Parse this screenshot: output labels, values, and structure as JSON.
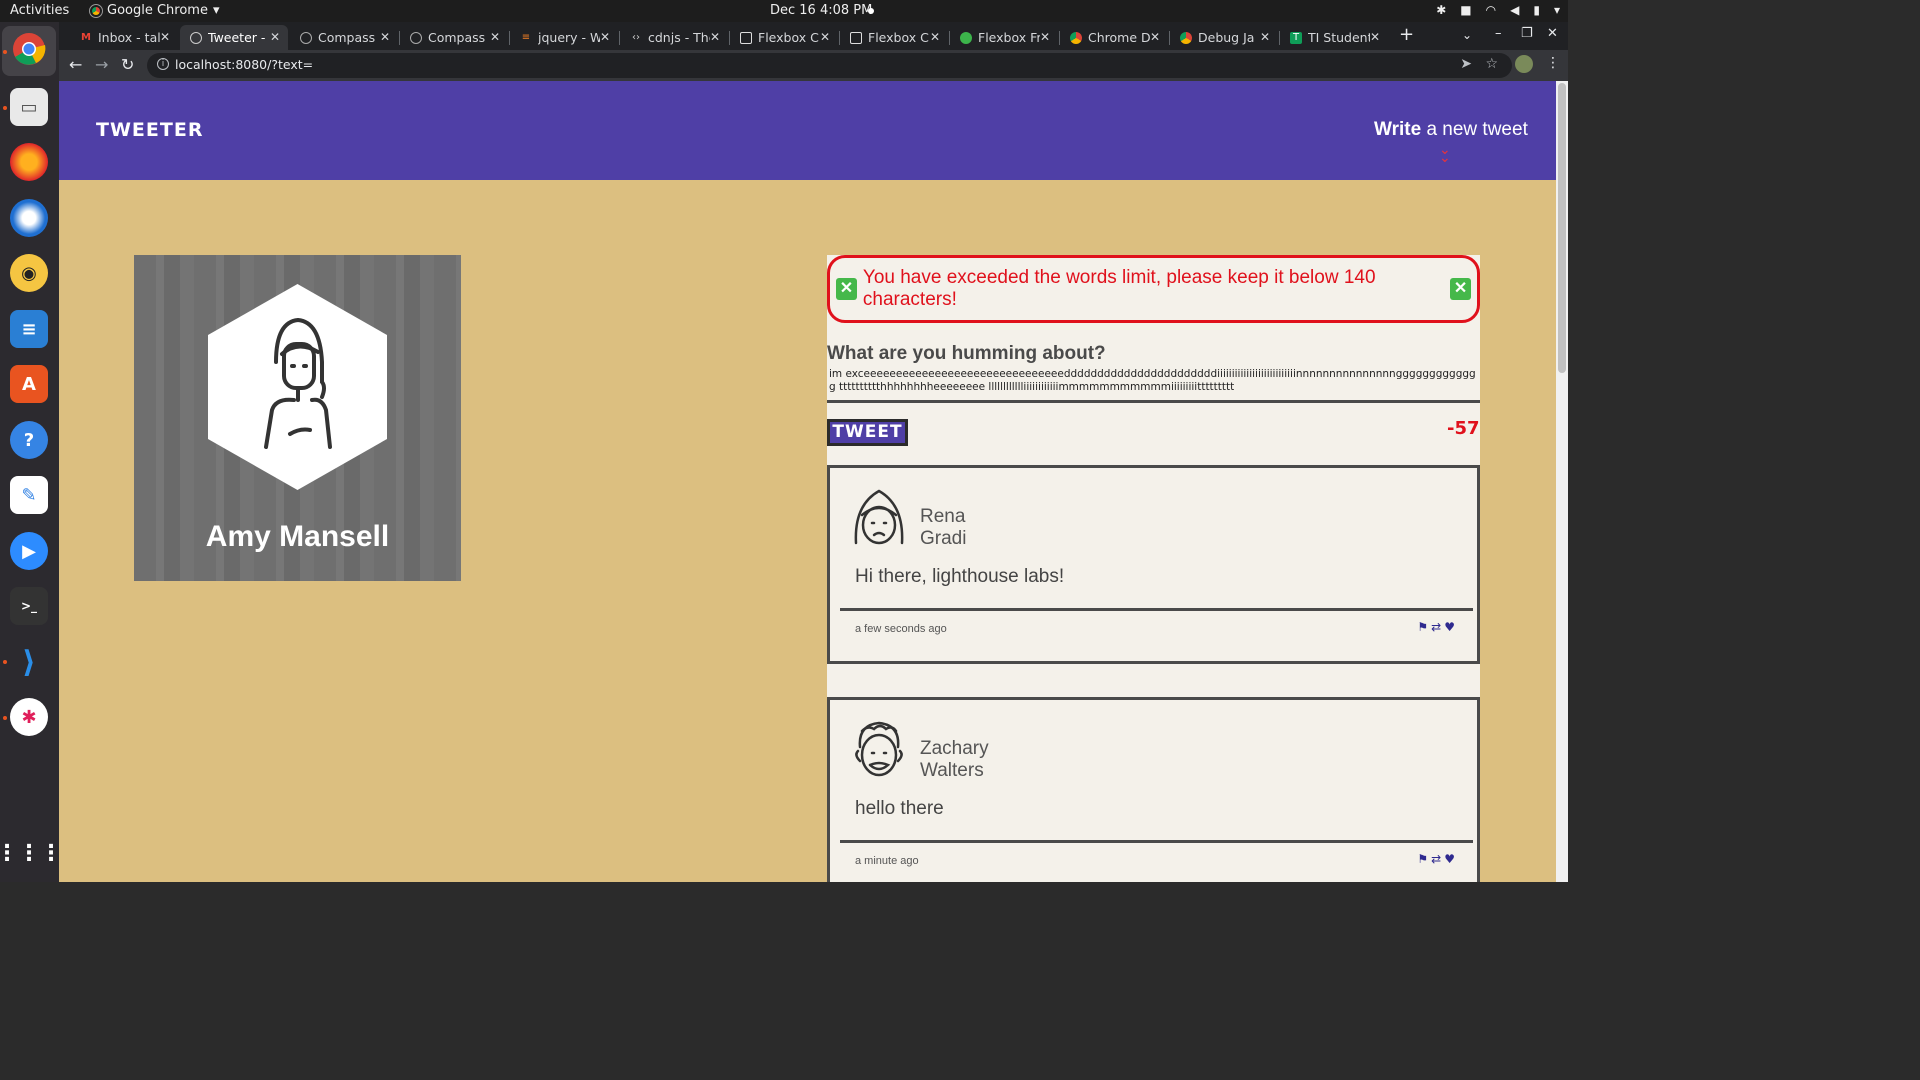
{
  "os": {
    "activities": "Activities",
    "app_name": "Google Chrome",
    "clock": "Dec 16  4:08 PM"
  },
  "tabs": [
    {
      "title": "Inbox - tal",
      "active": false
    },
    {
      "title": "Tweeter - l",
      "active": true
    },
    {
      "title": "Compass |",
      "active": false
    },
    {
      "title": "Compass |",
      "active": false
    },
    {
      "title": "jquery - W",
      "active": false
    },
    {
      "title": "cdnjs - The",
      "active": false
    },
    {
      "title": "Flexbox Ch",
      "active": false
    },
    {
      "title": "Flexbox Ch",
      "active": false
    },
    {
      "title": "Flexbox Fr",
      "active": false
    },
    {
      "title": "Chrome D",
      "active": false
    },
    {
      "title": "Debug Ja",
      "active": false
    },
    {
      "title": "TI Student",
      "active": false
    }
  ],
  "browser": {
    "url": "localhost:8080/?text="
  },
  "nav": {
    "brand": "TWEETER",
    "write_bold": "Write",
    "write_rest": " a new tweet"
  },
  "profile": {
    "name": "Amy Mansell"
  },
  "compose": {
    "error": "You have exceeded the words limit, please keep it below 140 characters!",
    "title": "What are you humming about?",
    "text": "im exceeeeeeeeeeeeeeeeeeeeeeeeeeeeeeedddddddddddddddddddddddiiiiiiiiiiiiiiiiiiiiiiiiiiinnnnnnnnnnnnnnnggggggggggggg tttttttttthhhhhhhheeeeeeee lllllllllllliiiiiiiiiiiimmmmmmmmmmmiiiiiiiiittttttttt",
    "button": "TWEET",
    "counter": "-57"
  },
  "tweets": [
    {
      "first": "Rena",
      "last": "Gradi",
      "content": "Hi there, lighthouse labs!",
      "time": "a few seconds ago"
    },
    {
      "first": "Zachary",
      "last": "Walters",
      "content": "hello there",
      "time": "a minute ago"
    }
  ],
  "colors": {
    "nav_bg": "#4f3fa6",
    "page_bg": "#dcbf80",
    "error": "#e0111c"
  }
}
